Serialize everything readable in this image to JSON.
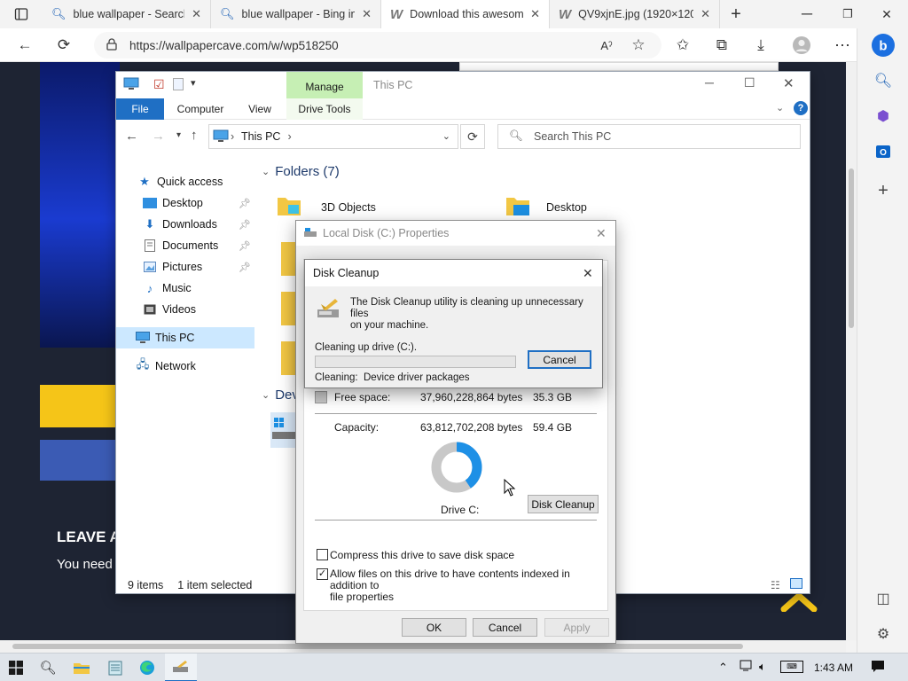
{
  "browser": {
    "tabs": [
      {
        "title": "blue wallpaper - Search",
        "active": false
      },
      {
        "title": "blue wallpaper - Bing in",
        "active": false
      },
      {
        "title": "Download this awesom",
        "active": true
      },
      {
        "title": "QV9xjnE.jpg (1920×120",
        "active": false
      }
    ],
    "url": "https://wallpapercave.com/w/wp518250"
  },
  "webpage": {
    "leave_heading": "LEAVE A",
    "you_need": "You need"
  },
  "explorer": {
    "window_title": "This PC",
    "ribbon_context": "Manage",
    "tabs": [
      "File",
      "Computer",
      "View",
      "Drive Tools"
    ],
    "path_label": "This PC",
    "search_placeholder": "Search This PC",
    "nav": {
      "quick_access": "Quick access",
      "desktop": "Desktop",
      "downloads": "Downloads",
      "documents": "Documents",
      "pictures": "Pictures",
      "music": "Music",
      "videos": "Videos",
      "this_pc": "This PC",
      "network": "Network"
    },
    "folders_header": "Folders (7)",
    "folder_3d": "3D Objects",
    "folder_desktop": "Desktop",
    "devices_header": "Dev",
    "status_items": "9 items",
    "status_selected": "1 item selected"
  },
  "properties": {
    "title": "Local Disk (C:) Properties",
    "free_label": "Free space:",
    "free_bytes": "37,960,228,864 bytes",
    "free_gb": "35.3 GB",
    "capacity_label": "Capacity:",
    "capacity_bytes": "63,812,702,208 bytes",
    "capacity_gb": "59.4 GB",
    "drive_label": "Drive C:",
    "disk_cleanup_button": "Disk Cleanup",
    "compress_label": "Compress this drive to save disk space",
    "compress_checked": false,
    "index_label_line1": "Allow files on this drive to have contents indexed in addition to",
    "index_label_line2": "file properties",
    "index_checked": true,
    "ok": "OK",
    "cancel": "Cancel",
    "apply": "Apply",
    "used_fraction": 0.405,
    "used_color": "#1e90e6",
    "free_color": "#c8c8c8"
  },
  "cleanup": {
    "title": "Disk Cleanup",
    "message_line1": "The Disk Cleanup utility is cleaning up unnecessary files",
    "message_line2": "on your machine.",
    "cleaning_drive": "Cleaning up drive  (C:).",
    "cancel": "Cancel",
    "cleaning_label": "Cleaning:",
    "cleaning_item": "Device driver packages",
    "progress": 0.0
  },
  "taskbar": {
    "time": "1:43 AM"
  }
}
